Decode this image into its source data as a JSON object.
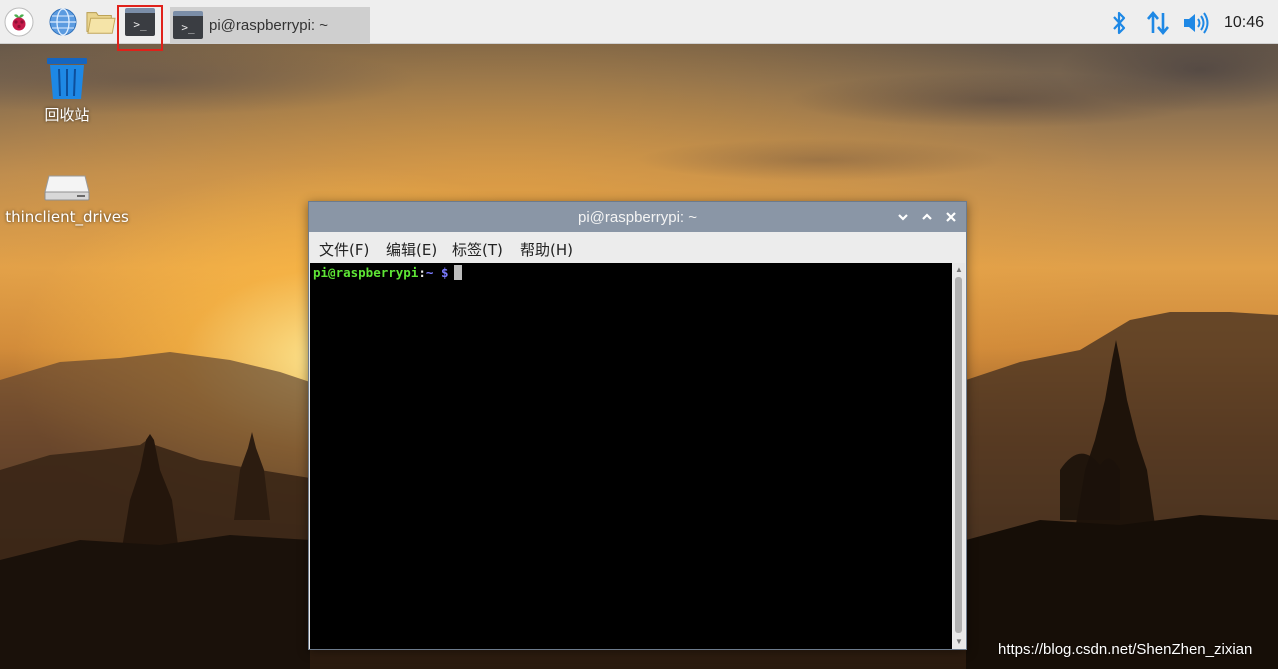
{
  "taskbar": {
    "launcher_terminal_glyph": ">_",
    "task_terminal_glyph": ">_",
    "task_label": "pi@raspberrypi: ~",
    "clock": "10:46",
    "icons": [
      "raspberry-pi-menu-icon",
      "web-browser-icon",
      "file-manager-icon",
      "terminal-icon",
      "bluetooth-icon",
      "network-icon",
      "volume-icon"
    ],
    "colors": {
      "bar": "#eeeeee",
      "highlight": "#e0211a",
      "tray_blue": "#1e88e5"
    }
  },
  "desktop": {
    "trash_label": "回收站",
    "drive_label": "thinclient_drives",
    "watermark": "https://blog.csdn.net/ShenZhen_zixian"
  },
  "terminal": {
    "title": "pi@raspberrypi: ~",
    "menu": [
      "文件(F)",
      "编辑(E)",
      "标签(T)",
      "帮助(H)"
    ],
    "prompt_user": "pi@raspberrypi",
    "prompt_sep": ":",
    "prompt_path": "~",
    "prompt_symbol": "$",
    "colors": {
      "user": "#5ee535",
      "path": "#7b7bff",
      "symbol": "#7b7bff",
      "titlebar": "#8a96a6"
    }
  }
}
